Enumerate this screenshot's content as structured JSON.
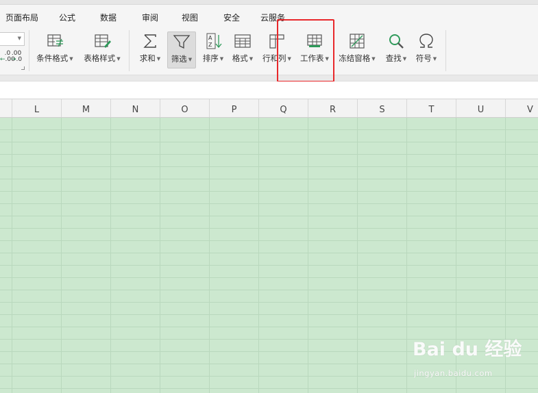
{
  "menu_tabs": [
    {
      "label": "页面布局"
    },
    {
      "label": "公式"
    },
    {
      "label": "数据"
    },
    {
      "label": "审阅"
    },
    {
      "label": "视图"
    },
    {
      "label": "安全"
    },
    {
      "label": "云服务"
    }
  ],
  "ribbon": {
    "decimal_increase": ".0",
    "decimal_increase_sub": ".00",
    "decimal_decrease": ".00",
    "decimal_decrease_sub": ".0",
    "conditional_format": "条件格式",
    "table_style": "表格样式",
    "sum": "求和",
    "filter": "筛选",
    "sort": "排序",
    "format": "格式",
    "rows_cols": "行和列",
    "worksheet": "工作表",
    "freeze_panes": "冻结窗格",
    "find": "查找",
    "symbol": "符号"
  },
  "columns": [
    "L",
    "M",
    "N",
    "O",
    "P",
    "Q",
    "R",
    "S",
    "T",
    "U",
    "V"
  ],
  "colors": {
    "grid_fill": "#cce8cf",
    "highlight": "#e8272a",
    "ribbon_bg": "#f5f5f5"
  },
  "watermark": {
    "logo": "Bai du 经验",
    "url": "jingyan.baidu.com"
  }
}
